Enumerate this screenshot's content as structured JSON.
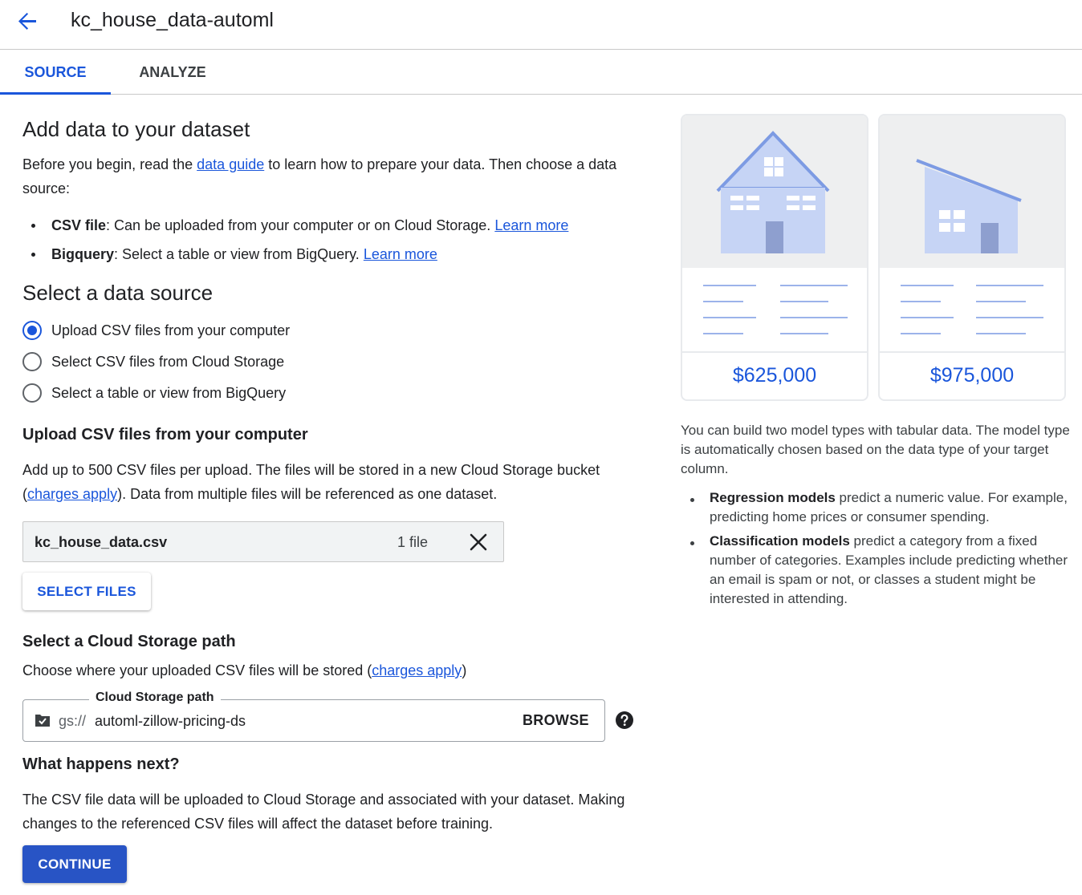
{
  "header": {
    "title": "kc_house_data-automl",
    "back_icon": "arrow-back-icon"
  },
  "tabs": [
    {
      "label": "SOURCE",
      "active": true
    },
    {
      "label": "ANALYZE",
      "active": false
    }
  ],
  "add_data": {
    "heading": "Add data to your dataset",
    "intro_before": "Before you begin, read the ",
    "intro_link": "data guide",
    "intro_after": " to learn how to prepare your data. Then choose a data source:",
    "bullets": [
      {
        "term": "CSV file",
        "text": ": Can be uploaded from your computer or on Cloud Storage. ",
        "link": "Learn more"
      },
      {
        "term": "Bigquery",
        "text": ": Select a table or view from BigQuery. ",
        "link": "Learn more"
      }
    ]
  },
  "data_source": {
    "heading": "Select a data source",
    "options": [
      {
        "label": "Upload CSV files from your computer",
        "selected": true
      },
      {
        "label": "Select CSV files from Cloud Storage",
        "selected": false
      },
      {
        "label": "Select a table or view from BigQuery",
        "selected": false
      }
    ]
  },
  "upload": {
    "heading": "Upload CSV files from your computer",
    "desc_before": "Add up to 500 CSV files per upload. The files will be stored in a new Cloud Storage bucket (",
    "desc_link": "charges apply",
    "desc_after": "). Data from multiple files will be referenced as one dataset.",
    "file_name": "kc_house_data.csv",
    "file_count": "1 file",
    "select_button": "SELECT FILES"
  },
  "storage": {
    "heading": "Select a Cloud Storage path",
    "desc_before": "Choose where your uploaded CSV files will be stored (",
    "desc_link": "charges apply",
    "desc_after": ")",
    "field_label": "Cloud Storage path",
    "prefix": "gs://",
    "value": "automl-zillow-pricing-ds",
    "browse_button": "BROWSE",
    "help_icon": "help-circle-icon"
  },
  "next": {
    "heading": "What happens next?",
    "text": "The CSV file data will be uploaded to Cloud Storage and associated with your dataset. Making changes to the referenced CSV files will affect the dataset before training.",
    "continue_button": "CONTINUE"
  },
  "cards": [
    {
      "price": "$625,000",
      "illustration": "house-tall-illustration"
    },
    {
      "price": "$975,000",
      "illustration": "house-slanted-illustration"
    }
  ],
  "side": {
    "intro": "You can build two model types with tabular data. The model type is automatically chosen based on the data type of your target column.",
    "bullets": [
      {
        "term": "Regression models",
        "text": " predict a numeric value. For example, predicting home prices or consumer spending."
      },
      {
        "term": "Classification models",
        "text": " predict a category from a fixed number of categories. Examples include predicting whether an email is spam or not, or classes a student might be interested in attending."
      }
    ]
  },
  "colors": {
    "accent": "#1a56db",
    "button_bg": "#2854c5",
    "house_fill": "#c6d4f5",
    "house_stroke": "#6b8de0"
  }
}
